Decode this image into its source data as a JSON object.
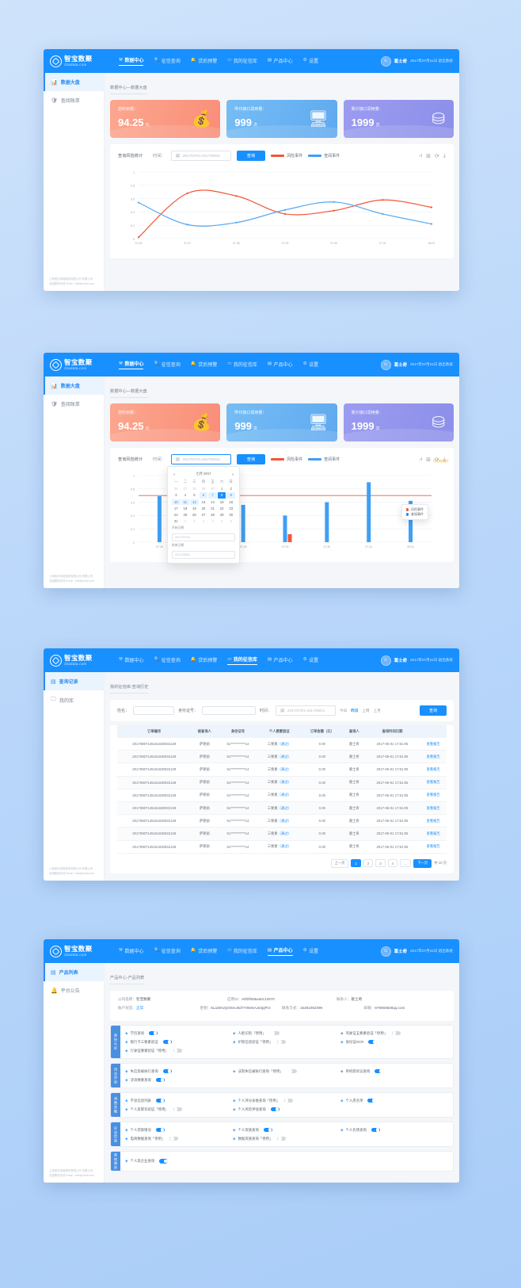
{
  "brand": {
    "cn": "智宝数聚",
    "en": "zbadata.com"
  },
  "nav": {
    "items": [
      {
        "label": "数据中心",
        "icon": "chart-icon"
      },
      {
        "label": "征信查询",
        "icon": "search-icon"
      },
      {
        "label": "贷后预警",
        "icon": "bell-icon"
      },
      {
        "label": "我的征信库",
        "icon": "database-icon"
      },
      {
        "label": "产品中心",
        "icon": "grid-icon"
      },
      {
        "label": "设置",
        "icon": "gear-icon"
      }
    ],
    "user": "葛士奇",
    "datetime": "2017年07月31日 退出系统"
  },
  "panel1": {
    "sidebar": [
      {
        "label": "数据大盘",
        "icon": "bar-chart-icon",
        "active": true
      },
      {
        "label": "查阅账单",
        "icon": "shield-icon",
        "active": false
      }
    ],
    "footer_line1": "上海宝贝网络服务有限公司 有限公司",
    "footer_line2": "全国服务热线 Email : mail@zbda.com",
    "breadcrumb": "数据中心—数据大盘",
    "cards": [
      {
        "label": "您的余额：",
        "value": "94.25",
        "unit": "元",
        "icon": "money-bag-icon",
        "color": "#fa9175"
      },
      {
        "label": "昨日接口调用量：",
        "value": "999",
        "unit": "次",
        "icon": "server-icon",
        "color": "#5fa9ef"
      },
      {
        "label": "累计接口调用量：",
        "value": "1999",
        "unit": "次",
        "icon": "sitemap-icon",
        "color": "#8c8fe9"
      }
    ],
    "chart": {
      "title": "查询风险统计",
      "date_label": "时间：",
      "date_value": "2017/07/01-2017/08/01",
      "query_button": "查询",
      "tools": [
        "line-chart-icon",
        "bar-chart-icon",
        "refresh-icon",
        "download-icon"
      ]
    }
  },
  "panel2": {
    "sidebar": [
      {
        "label": "数据大盘",
        "icon": "bar-chart-icon",
        "active": true
      },
      {
        "label": "查阅账单",
        "icon": "shield-icon",
        "active": false
      }
    ],
    "breadcrumb": "数据中心—数据大盘",
    "calendar": {
      "title": "七月 2017",
      "prev": "«",
      "next": "»",
      "weekdays": [
        "一",
        "二",
        "三",
        "四",
        "五",
        "六",
        "日"
      ],
      "weeks": [
        [
          "26",
          "27",
          "28",
          "29",
          "30",
          "1",
          "2"
        ],
        [
          "3",
          "4",
          "5",
          "6",
          "7",
          "8",
          "9"
        ],
        [
          "10",
          "11",
          "12",
          "13",
          "14",
          "15",
          "16"
        ],
        [
          "17",
          "18",
          "19",
          "20",
          "21",
          "22",
          "23"
        ],
        [
          "24",
          "25",
          "26",
          "27",
          "28",
          "29",
          "30"
        ],
        [
          "31",
          "1",
          "2",
          "3",
          "4",
          "5",
          "6"
        ]
      ],
      "start_label": "开始日期",
      "end_label": "结束日期",
      "start_placeholder": "2017/07/01",
      "end_placeholder": "2017/08/01"
    },
    "tooltip": [
      {
        "name": "风险事件",
        "color": "#f2563a"
      },
      {
        "name": "查阅事件",
        "color": "#1890ff"
      }
    ],
    "save_hint": "可另存图片"
  },
  "panel3": {
    "sidebar": [
      {
        "label": "查询记录",
        "icon": "doc-icon",
        "active": true
      },
      {
        "label": "我的库",
        "icon": "folder-icon",
        "active": false
      }
    ],
    "breadcrumb": "我的征信库-查询历史",
    "filters": {
      "name_label": "姓名：",
      "id_label": "身份证号：",
      "time_label": "时间：",
      "date_value": "2017/07/01-2017/08/01",
      "quick": [
        "今日",
        "昨日",
        "上周",
        "上月"
      ],
      "quick_active": "昨日",
      "query_button": "查询"
    },
    "table": {
      "columns": [
        "订单编号",
        "被查询人",
        "身份证号",
        "个人要素验证",
        "订单金额（元）",
        "查询人",
        "查询时间日期",
        ""
      ],
      "rows": [
        [
          "20170807145161630032129",
          "萨德丽",
          "51***********14",
          "三要素（通过）",
          "0.00",
          "葛士奇",
          "2017-06-01 17:51:05",
          "查看报告"
        ],
        [
          "20170807145161630032129",
          "萨德丽",
          "51***********14",
          "三要素（通过）",
          "0.00",
          "葛士奇",
          "2017-06-01 17:51:05",
          "查看报告"
        ],
        [
          "20170807145161630032129",
          "萨德丽",
          "51***********14",
          "三要素（通过）",
          "0.00",
          "葛士奇",
          "2017-06-01 17:51:05",
          "查看报告"
        ],
        [
          "20170807145161630032129",
          "萨德丽",
          "51***********14",
          "三要素（通过）",
          "0.00",
          "葛士奇",
          "2017-06-01 17:51:05",
          "查看报告"
        ],
        [
          "20170807145161630032129",
          "萨德丽",
          "51***********14",
          "三要素（通过）",
          "0.00",
          "葛士奇",
          "2017-06-01 17:51:05",
          "查看报告"
        ],
        [
          "20170807145161630032129",
          "萨德丽",
          "51***********14",
          "三要素（通过）",
          "0.00",
          "葛士奇",
          "2017-06-01 17:51:05",
          "查看报告"
        ],
        [
          "20170807145161630032129",
          "萨德丽",
          "51***********14",
          "三要素（通过）",
          "0.00",
          "葛士奇",
          "2017-06-01 17:51:05",
          "查看报告"
        ],
        [
          "20170807145161630032129",
          "萨德丽",
          "51***********14",
          "三要素（通过）",
          "0.00",
          "葛士奇",
          "2017-06-01 17:51:05",
          "查看报告"
        ],
        [
          "20170807145161630032129",
          "萨德丽",
          "51***********14",
          "三要素（通过）",
          "0.00",
          "葛士奇",
          "2017-06-01 17:51:05",
          "查看报告"
        ]
      ]
    },
    "pager": {
      "prev": "上一页",
      "pages": [
        "1",
        "2",
        "3",
        "4",
        "…"
      ],
      "active": "1",
      "next": "下一页",
      "total": "共 10 页"
    }
  },
  "panel4": {
    "sidebar": [
      {
        "label": "产品列表",
        "icon": "grid-icon",
        "active": true
      },
      {
        "label": "平台公告",
        "icon": "bell-icon",
        "active": false
      }
    ],
    "breadcrumb": "产品中心-产品列表",
    "info": {
      "rows": [
        [
          {
            "k": "公司名称：",
            "v": "智宝数聚"
          },
          {
            "k": "应用ID：",
            "v": "e0f2f055wa0c12870"
          },
          {
            "k": "联系人：",
            "v": "葛士奇"
          }
        ],
        [
          {
            "k": "账户状态：",
            "v": "正常",
            "blue": true
          },
          {
            "k": "密钥：",
            "v": "6La30nvQO6mJ0d7Y06e5AJx0pjPr2"
          },
          {
            "k": "联系方式：",
            "v": "15281062399"
          },
          {
            "k": "邮箱：",
            "v": "979656828qq.com"
          }
        ]
      ]
    },
    "groups": [
      {
        "tag": "身份认证",
        "items": [
          {
            "label": "学历查询",
            "icon": "cap-icon",
            "on": true
          },
          {
            "label": "人脸识别「停用」",
            "icon": "face-icon",
            "on": false
          },
          {
            "label": "驾驶证五要素验证「停用」",
            "icon": "car-icon",
            "on": false
          },
          {
            "label": "银行卡三要素验证",
            "icon": "card-icon",
            "on": true
          },
          {
            "label": "护照信息验证「停用」",
            "icon": "passport-icon",
            "on": false
          },
          {
            "label": "身份证OCR",
            "icon": "idcard-icon",
            "on": true
          },
          {
            "label": "行驶证要素验证「停用」",
            "icon": "vehicle-icon",
            "on": false
          }
        ]
      },
      {
        "tag": "司法涉诉",
        "items": [
          {
            "label": "失信及被执行查询",
            "icon": "gavel-icon",
            "on": true
          },
          {
            "label": "法院失信被执行查询「停用」",
            "icon": "court-icon",
            "on": false
          },
          {
            "label": "单机等诉讼查询",
            "icon": "case-icon",
            "on": true
          },
          {
            "label": "涉诉要素查询",
            "icon": "lawsuit-icon",
            "on": true
          }
        ]
      },
      {
        "tag": "消费金融",
        "items": [
          {
            "label": "不良信息列表",
            "icon": "warn-icon",
            "on": true
          },
          {
            "label": "个人评分多维查询「停用」",
            "icon": "score-icon",
            "on": false
          },
          {
            "label": "个人黑名单",
            "icon": "black-icon",
            "on": true
          },
          {
            "label": "个人反欺诈验证「停用」",
            "icon": "fraud-icon",
            "on": false
          },
          {
            "label": "个人风险评估查询",
            "icon": "risk-icon",
            "on": true
          }
        ]
      },
      {
        "tag": "企业信息",
        "items": [
          {
            "label": "个人贷款情况",
            "icon": "loan-icon",
            "on": true
          },
          {
            "label": "个人资质查询",
            "icon": "quality-icon",
            "on": true
          },
          {
            "label": "个人负债查询",
            "icon": "debt-icon",
            "on": true
          },
          {
            "label": "电商数据查询「停用」",
            "icon": "shop-icon",
            "on": false
          },
          {
            "label": "数据资质查询「停用」",
            "icon": "data-icon",
            "on": false
          }
        ]
      },
      {
        "tag": "其他服务",
        "items": [
          {
            "label": "个人及企业查询",
            "icon": "org-icon",
            "on": true
          }
        ]
      }
    ]
  },
  "chart_data": [
    {
      "type": "line",
      "title": "查询风险统计",
      "x": [
        "07-26",
        "07-27",
        "07-28",
        "07-29",
        "07-30",
        "07-31",
        "08-01"
      ],
      "ylim": [
        0,
        1
      ],
      "yticks": [
        0,
        0.2,
        0.4,
        0.6,
        0.8,
        1
      ],
      "grid": true,
      "legend_position": "top",
      "series": [
        {
          "name": "风险事件",
          "color": "#f2563a",
          "values": [
            0.02,
            0.68,
            0.64,
            0.37,
            0.42,
            0.58,
            0.47
          ]
        },
        {
          "name": "查阅事件",
          "color": "#54a8ef",
          "values": [
            0.54,
            0.21,
            0.24,
            0.43,
            0.55,
            0.37,
            0.22
          ]
        }
      ]
    },
    {
      "type": "bar",
      "title": "查询风险统计",
      "x": [
        "07-26",
        "07-27",
        "07-28",
        "07-29",
        "07-30",
        "07-31",
        "08-01"
      ],
      "ylim": [
        0,
        1
      ],
      "yticks": [
        0,
        0.2,
        0.4,
        0.6,
        0.8,
        1
      ],
      "grid": true,
      "threshold": 0.7,
      "legend_position": "top",
      "series": [
        {
          "name": "查阅事件",
          "color": "#3f9ff5",
          "values": [
            0.69,
            0.52,
            0.56,
            0.4,
            0.6,
            0.9,
            0.62
          ]
        },
        {
          "name": "风险事件",
          "color": "#f2563a",
          "values": [
            0,
            0,
            0,
            0.12,
            0,
            0,
            0
          ]
        }
      ]
    }
  ]
}
